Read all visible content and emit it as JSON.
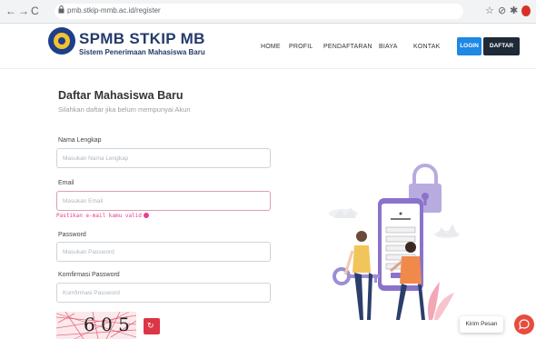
{
  "browser": {
    "url": "pmb.stkip-mmb.ac.id/register"
  },
  "header": {
    "brand_title": "SPMB STKIP MB",
    "brand_subtitle": "Sistem Penerimaan Mahasiswa Baru",
    "menu": [
      {
        "label": "HOME"
      },
      {
        "label": "PROFIL"
      },
      {
        "label": "PENDAFTARAN"
      },
      {
        "label": "BIAYA"
      },
      {
        "label": "KONTAK"
      }
    ],
    "login_label": "LOGIN",
    "daftar_label": "DAFTAR"
  },
  "form": {
    "title": "Daftar Mahasiswa Baru",
    "subtitle": "Silahkan daftar jika belum mempunyai Akun",
    "fields": {
      "nama": {
        "label": "Nama Lengkap",
        "placeholder": "Masukan Nama Lengkap",
        "value": ""
      },
      "email": {
        "label": "Email",
        "placeholder": "Masukan Email",
        "value": "",
        "error": "Pastikan e-mail kamu valid"
      },
      "password": {
        "label": "Password",
        "placeholder": "Masukan Password",
        "value": ""
      },
      "konfirmasi": {
        "label": "Komfirmasi Password",
        "placeholder": "Komfirmasi Password",
        "value": ""
      }
    },
    "captcha_text": "6 0 5"
  },
  "chat": {
    "label": "Kirim Pesan"
  },
  "colors": {
    "primary": "#1e88e5",
    "dark": "#1f2a37",
    "brand": "#233b6b",
    "error": "#e83e8c",
    "danger": "#dc3545",
    "chat": "#e84c3d",
    "illustration": "#8a73c9"
  }
}
